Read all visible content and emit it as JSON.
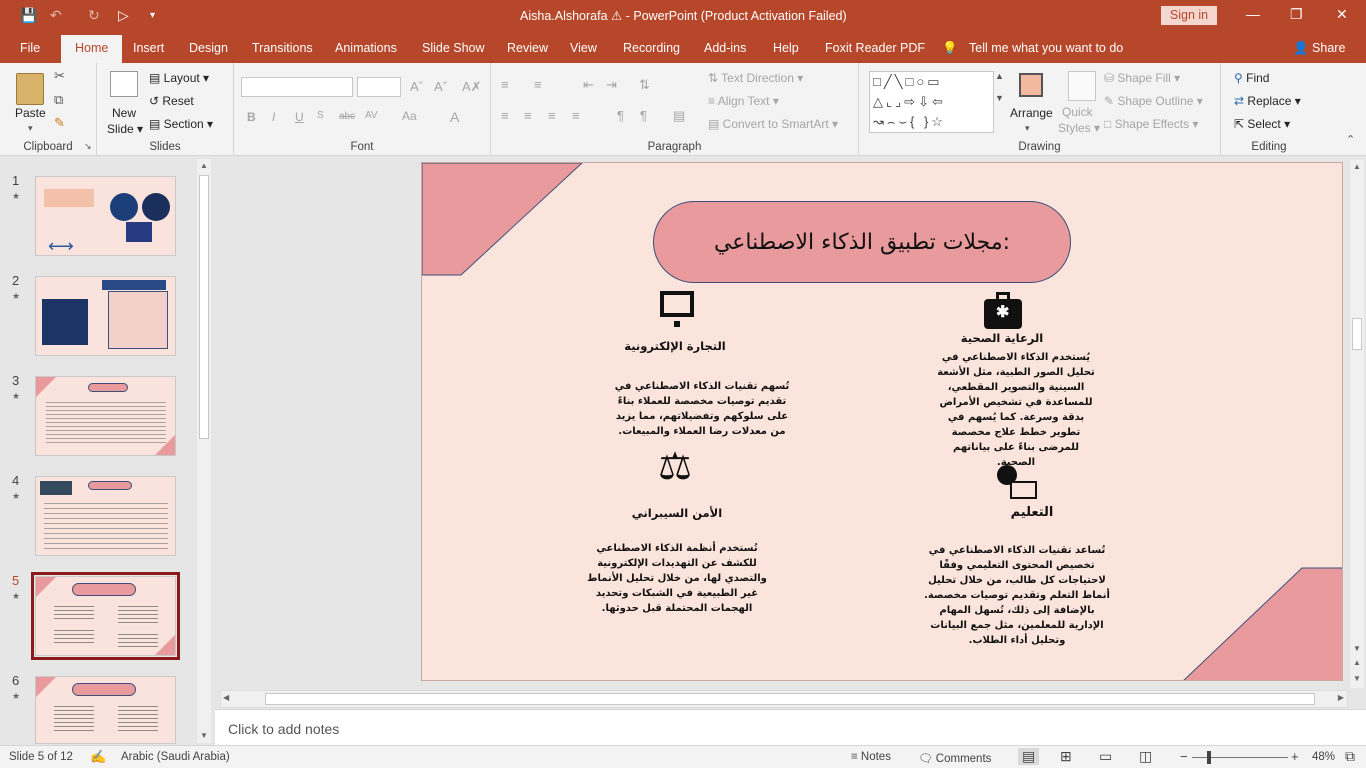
{
  "window": {
    "title": "Aisha.Alshorafa",
    "app_title": "PowerPoint (Product Activation Failed)",
    "sign_in": "Sign in"
  },
  "tabs": [
    "File",
    "Home",
    "Insert",
    "Design",
    "Transitions",
    "Animations",
    "Slide Show",
    "Review",
    "View",
    "Recording",
    "Add-ins",
    "Help",
    "Foxit Reader PDF"
  ],
  "tell_me": "Tell me what you want to do",
  "share": "Share",
  "ribbon": {
    "clipboard": {
      "label": "Clipboard",
      "paste": "Paste"
    },
    "slides": {
      "label": "Slides",
      "new_slide_1": "New",
      "new_slide_2": "Slide",
      "layout": "Layout",
      "reset": "Reset",
      "section": "Section"
    },
    "font": {
      "label": "Font",
      "bold": "B",
      "italic": "I",
      "underline": "U",
      "strike": "abc",
      "spacing": "AV",
      "case": "Aa",
      "color": "A"
    },
    "paragraph": {
      "label": "Paragraph",
      "text_direction": "Text Direction",
      "align_text": "Align Text",
      "smartart": "Convert to SmartArt"
    },
    "drawing": {
      "label": "Drawing",
      "arrange": "Arrange",
      "quick_styles_1": "Quick",
      "quick_styles_2": "Styles",
      "shape_fill": "Shape Fill",
      "shape_outline": "Shape Outline",
      "shape_effects": "Shape Effects"
    },
    "editing": {
      "label": "Editing",
      "find": "Find",
      "replace": "Replace",
      "select": "Select"
    }
  },
  "thumbnails": [
    {
      "num": "1",
      "selected": false
    },
    {
      "num": "2",
      "selected": false
    },
    {
      "num": "3",
      "selected": false
    },
    {
      "num": "4",
      "selected": false
    },
    {
      "num": "5",
      "selected": true
    },
    {
      "num": "6",
      "selected": false
    }
  ],
  "slide": {
    "title": "مجلات تطبيق الذكاء الاصطناعي:",
    "sections": {
      "healthcare": {
        "heading": "الرعاية الصحية",
        "body": "يُستخدم الذكاء الاصطناعي في تحليل الصور الطبية، مثل الأشعة السينية والتصوير المقطعي، للمساعدة في تشخيص الأمراض بدقة وسرعة. كما يُسهم في تطوير خطط علاج مخصصة للمرضى بناءً على بياناتهم الصحية."
      },
      "ecommerce": {
        "heading": "التجارة الإلكترونية",
        "body": "تُسهم تقنيات الذكاء الاصطناعي في تقديم توصيات مخصصة للعملاء بناءً على سلوكهم وتفضيلاتهم، مما يزيد من معدلات رضا العملاء والمبيعات."
      },
      "cybersecurity": {
        "heading": "الأمن السيبراني",
        "body": "تُستخدم أنظمة الذكاء الاصطناعي للكشف عن التهديدات الإلكترونية والتصدي لها، من خلال تحليل الأنماط غير الطبيعية في الشبكات وتحديد الهجمات المحتملة قبل حدوثها."
      },
      "education": {
        "heading": "التعليم",
        "body": "تُساعد تقنيات الذكاء الاصطناعي في تخصيص المحتوى التعليمي وفقًا لاحتياجات كل طالب، من خلال تحليل أنماط التعلم وتقديم توصيات مخصصة. بالإضافة إلى ذلك، تُسهل المهام الإدارية للمعلمين، مثل جمع البيانات وتحليل أداء الطلاب."
      }
    }
  },
  "notes_placeholder": "Click to add notes",
  "status": {
    "slide_counter": "Slide 5 of 12",
    "language": "Arabic (Saudi Arabia)",
    "notes": "Notes",
    "comments": "Comments",
    "zoom": "48%"
  },
  "colors": {
    "accent": "#b7472a",
    "slide_bg": "#fbe4dc",
    "pink": "#e89a9d",
    "navy": "#3d4f7a"
  }
}
